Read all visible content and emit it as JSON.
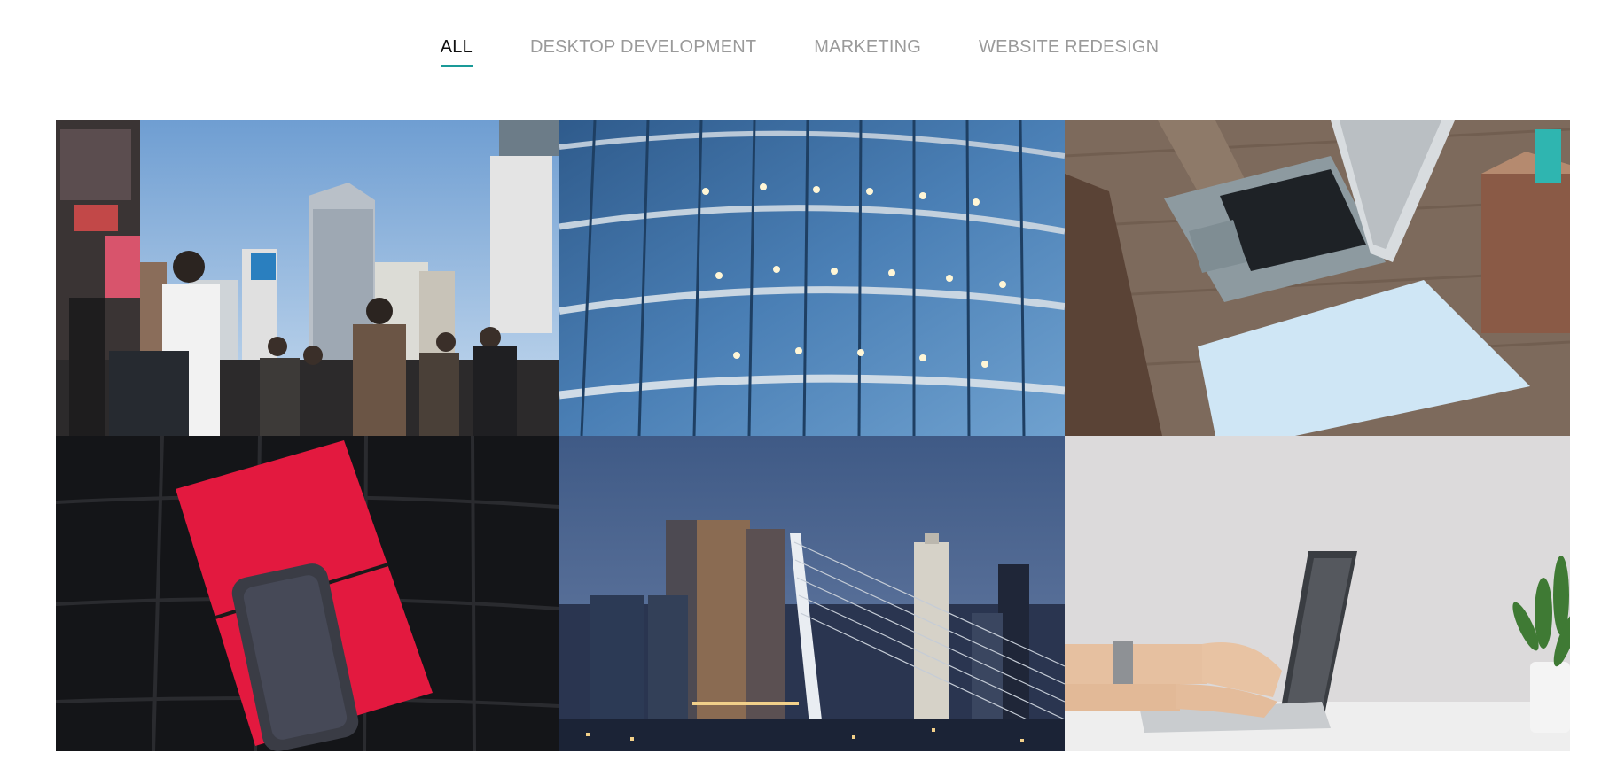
{
  "filters": {
    "tabs": [
      {
        "label": "ALL",
        "active": true
      },
      {
        "label": "DESKTOP DEVELOPMENT",
        "active": false
      },
      {
        "label": "MARKETING",
        "active": false
      },
      {
        "label": "WEBSITE REDESIGN",
        "active": false
      }
    ],
    "accent_color": "#1a9a98"
  },
  "gallery": {
    "items": [
      {
        "subject": "city-crowd-photo"
      },
      {
        "subject": "glass-building-photo"
      },
      {
        "subject": "laptop-on-desk-photo"
      },
      {
        "subject": "red-notebook-phone-photo"
      },
      {
        "subject": "city-skyline-bridge-photo"
      },
      {
        "subject": "hands-typing-laptop-photo"
      }
    ]
  }
}
